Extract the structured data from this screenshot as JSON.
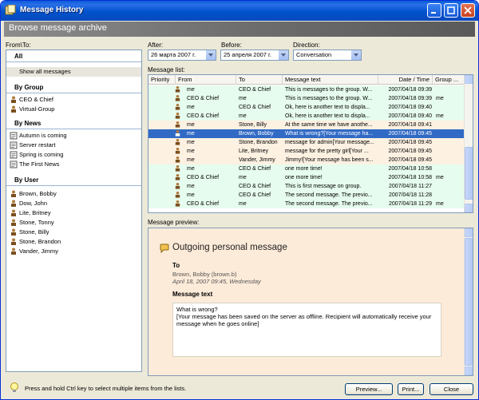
{
  "window": {
    "title": "Message History"
  },
  "banner": {
    "title": "Browse message archive"
  },
  "left": {
    "label": "From\\To:",
    "all_header": "All",
    "show_all": "Show all messages",
    "by_group_header": "By Group",
    "groups": [
      "CEO & Chief",
      "Virtual-Group"
    ],
    "by_news_header": "By News",
    "news": [
      "Autumn is coming",
      "Server restart",
      "Spring is coming",
      "The First News"
    ],
    "by_user_header": "By User",
    "users": [
      "Brown, Bobby",
      "Dow, John",
      "Lite, Britney",
      "Stone, Tonny",
      "Stone, Billy",
      "Stone, Brandon",
      "Vander, Jimmy"
    ]
  },
  "filters": {
    "after_label": "After:",
    "after_value": "26   марта   2007 г.",
    "before_label": "Before:",
    "before_value": "25  апреля   2007 г.",
    "direction_label": "Direction:",
    "direction_value": "Conversation"
  },
  "list": {
    "label": "Message list:",
    "headers": [
      "Priority",
      "From",
      "To",
      "Message text",
      "Date / Time",
      "Group ..."
    ],
    "rows": [
      {
        "from": "me",
        "to": "CEO & Chief",
        "text": "This is messages to the group. W...",
        "date": "2007/04/18 09:39",
        "group": "",
        "style": "green"
      },
      {
        "from": "CEO & Chief",
        "to": "me",
        "text": "This is messages to the group. W...",
        "date": "2007/04/18 09:39",
        "group": "me",
        "style": "green"
      },
      {
        "from": "me",
        "to": "CEO & Chief",
        "text": "Ok, here is another text to displa...",
        "date": "2007/04/18 09:40",
        "group": "",
        "style": "green"
      },
      {
        "from": "CEO & Chief",
        "to": "me",
        "text": "Ok, here is another text to displa...",
        "date": "2007/04/18 09:40",
        "group": "me",
        "style": "green"
      },
      {
        "from": "me",
        "to": "Stone, Billy",
        "text": "At the same time we have anothe...",
        "date": "2007/04/18 09:41",
        "group": "",
        "style": "peach"
      },
      {
        "from": "me",
        "to": "Brown, Bobby",
        "text": "What is wrong?[Your message ha...",
        "date": "2007/04/18 09:45",
        "group": "",
        "style": "sel"
      },
      {
        "from": "me",
        "to": "Stone, Brandon",
        "text": "message for admin[Your message...",
        "date": "2007/04/18 09:45",
        "group": "",
        "style": "peach"
      },
      {
        "from": "me",
        "to": "Lite, Britney",
        "text": "message for the pretty girl[Your ...",
        "date": "2007/04/18 09:45",
        "group": "",
        "style": "peach"
      },
      {
        "from": "me",
        "to": "Vander, Jimmy",
        "text": "Jimmy![Your message has been s...",
        "date": "2007/04/18 09:45",
        "group": "",
        "style": "peach"
      },
      {
        "from": "me",
        "to": "CEO & Chief",
        "text": "one more time!",
        "date": "2007/04/18 10:58",
        "group": "",
        "style": "green"
      },
      {
        "from": "CEO & Chief",
        "to": "me",
        "text": "one more time!",
        "date": "2007/04/18 10:58",
        "group": "me",
        "style": "green"
      },
      {
        "from": "me",
        "to": "CEO & Chief",
        "text": "This is first message on group.",
        "date": "2007/04/18 11:27",
        "group": "",
        "style": "green"
      },
      {
        "from": "me",
        "to": "CEO & Chief",
        "text": "The second message. The previo...",
        "date": "2007/04/18 11:28",
        "group": "",
        "style": "green"
      },
      {
        "from": "CEO & Chief",
        "to": "me",
        "text": "The second message. The previo...",
        "date": "2007/04/18 11:29",
        "group": "me",
        "style": "green"
      }
    ]
  },
  "preview": {
    "label": "Message preview:",
    "title": "Outgoing personal message",
    "to_label": "To",
    "to_value": "Brown, Bobby (brown.b)",
    "date_value": "April 18, 2007 09:45, Wednesday",
    "text_label": "Message text",
    "text_line1": "What is wrong?",
    "text_line2": "[Your message has been saved on the server as offline. Recipient will automatically receive your message when he goes online]"
  },
  "footer": {
    "hint": "Press and hold Ctrl key to select multiple items from the lists.",
    "preview_button": "Preview...",
    "print_button": "Print...",
    "close_button": "Close"
  },
  "colors": {
    "title_blue": "#0052cc",
    "selection": "#316ac5",
    "green_row": "#e6fcee",
    "peach_row": "#fdf1e2"
  },
  "icons": {
    "user": "user-icon",
    "news": "news-icon",
    "hint": "lightbulb-icon",
    "preview_header": "speech-bubble-icon"
  }
}
